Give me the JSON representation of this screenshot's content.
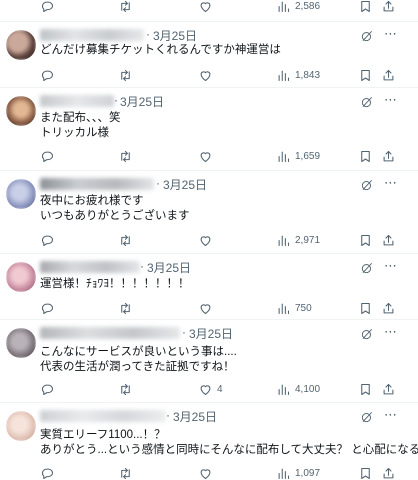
{
  "top_actions": {
    "views": "2,586"
  },
  "posts": [
    {
      "date": "3月25日",
      "lines": [
        "どんだけ募集チケットくれるんですか神運営は"
      ],
      "replies": "",
      "views": "1,843"
    },
    {
      "date": "3月25日",
      "lines": [
        "また配布、、、笑",
        "トリッカル様"
      ],
      "replies": "",
      "views": "1,659"
    },
    {
      "date": "3月25日",
      "lines": [
        "夜中にお疲れ様です",
        "いつもありがとうございます"
      ],
      "replies": "",
      "views": "2,971"
    },
    {
      "date": "3月25日",
      "lines": [
        "運営様！ﾁｮﾜﾖ！！！！！！！"
      ],
      "replies": "",
      "views": "750"
    },
    {
      "date": "3月25日",
      "lines": [
        "こんなにサービスが良いという事は....",
        "代表の生活が潤ってきた証拠ですね！"
      ],
      "replies": "4",
      "views": "4,100"
    },
    {
      "date": "3月25日",
      "lines": [
        "実質エリーフ1100...！？",
        "ありがとう...という感情と同時にそんなに配布して大丈夫？ と心配になる"
      ],
      "replies": "",
      "views": "1,097"
    }
  ],
  "icons": [
    "reply-icon",
    "retweet-icon",
    "like-icon",
    "views-icon",
    "bookmark-icon",
    "share-icon",
    "grok-icon",
    "more-icon"
  ],
  "colors": {
    "text": "#0f1419",
    "muted": "#536471",
    "divider": "#eff3f4"
  }
}
